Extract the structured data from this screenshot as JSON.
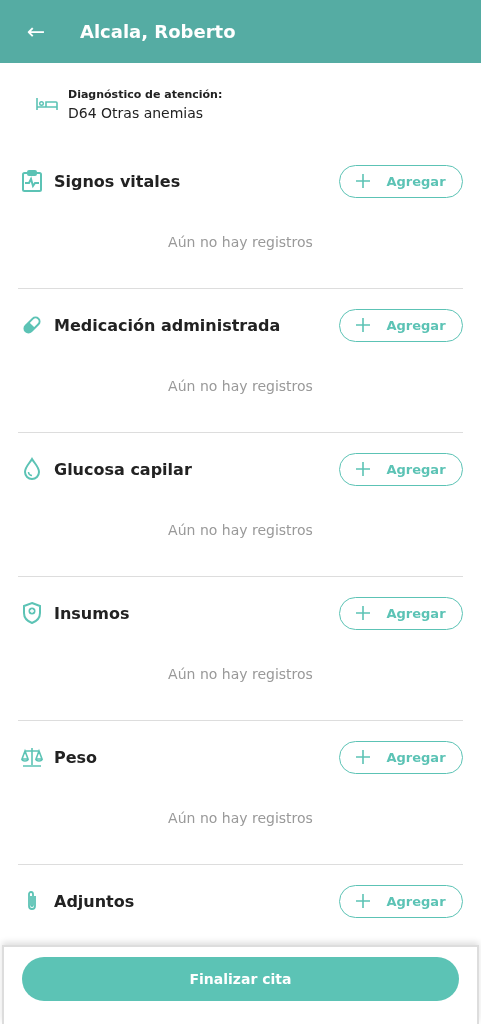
{
  "header": {
    "back": "←",
    "title": "Alcala, Roberto"
  },
  "diagnosis": {
    "label": "Diagnóstico de atención:",
    "value": "D64 Otras anemias"
  },
  "sections": [
    {
      "title": "Signos vitales",
      "button": "Agregar",
      "empty_text": "Aún no hay registros"
    },
    {
      "title": "Medicación administrada",
      "button": "Agregar",
      "empty_text": "Aún no hay registros"
    },
    {
      "title": "Glucosa capilar",
      "button": "Agregar",
      "empty_text": "Aún no hay registros"
    },
    {
      "title": "Insumos",
      "button": "Agregar",
      "empty_text": "Aún no hay registros"
    },
    {
      "title": "Peso",
      "button": "Agregar",
      "empty_text": "Aún no hay registros"
    },
    {
      "title": "Adjuntos",
      "button": "Agregar"
    }
  ],
  "footer": {
    "button": "Finalizar cita"
  }
}
